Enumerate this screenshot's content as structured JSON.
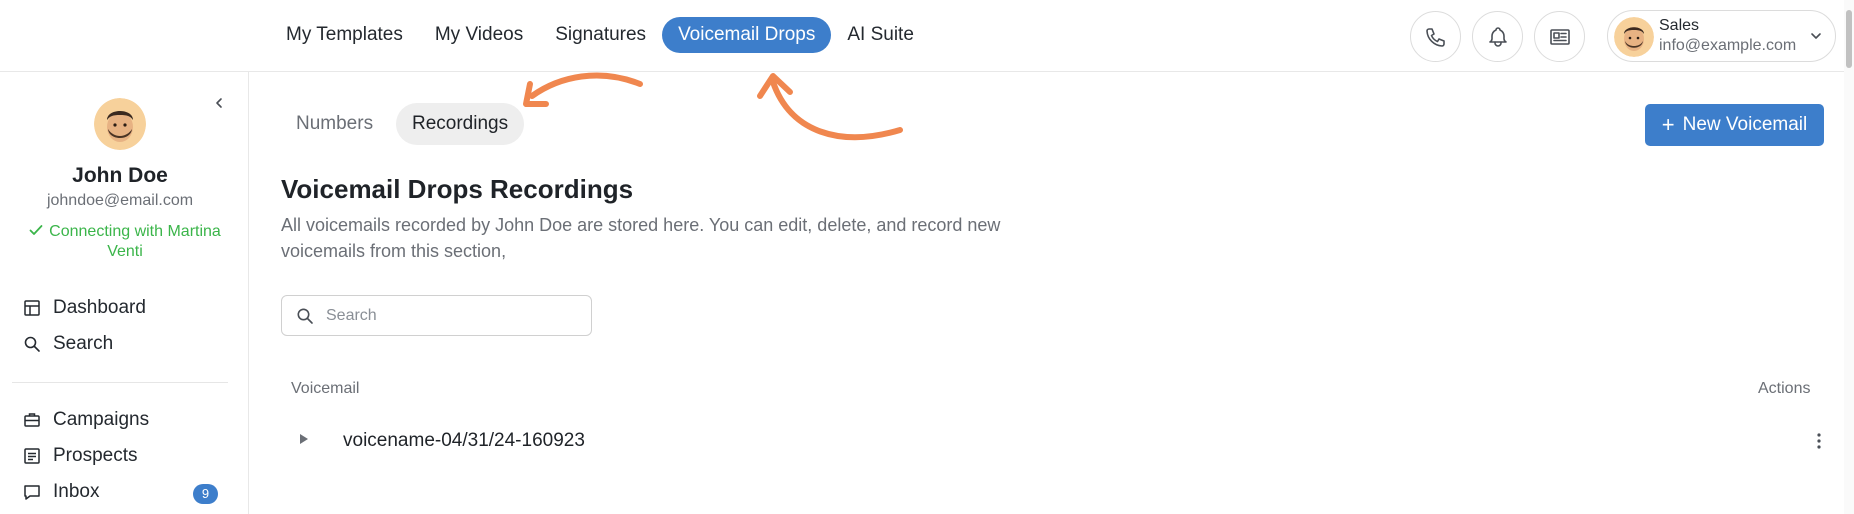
{
  "topnav": {
    "items": [
      {
        "label": "My Templates"
      },
      {
        "label": "My Videos"
      },
      {
        "label": "Signatures"
      },
      {
        "label": "Voicemail Drops",
        "active": true
      },
      {
        "label": "AI Suite"
      }
    ]
  },
  "header_icons": [
    "phone-icon",
    "bell-icon",
    "newspaper-icon"
  ],
  "account": {
    "name": "Sales",
    "email": "info@example.com"
  },
  "sidebar": {
    "profile": {
      "name": "John Doe",
      "email": "johndoe@email.com",
      "status": "Connecting with Martina Venti"
    },
    "items": [
      {
        "label": "Dashboard",
        "icon": "layout-icon"
      },
      {
        "label": "Search",
        "icon": "search-icon"
      },
      {
        "label": "Campaigns",
        "icon": "briefcase-icon"
      },
      {
        "label": "Prospects",
        "icon": "list-icon"
      },
      {
        "label": "Inbox",
        "icon": "message-icon",
        "badge": "9"
      }
    ]
  },
  "main": {
    "tabs": [
      {
        "label": "Numbers"
      },
      {
        "label": "Recordings",
        "active": true
      }
    ],
    "new_button": "New Voicemail",
    "title": "Voicemail Drops Recordings",
    "description": "All voicemails recorded by John Doe are stored here. You can edit, delete, and record new voicemails from this section,",
    "search": {
      "placeholder": "Search",
      "value": ""
    },
    "table": {
      "columns": [
        "Voicemail",
        "Actions"
      ],
      "rows": [
        {
          "name": "voicename-04/31/24-160923"
        }
      ]
    }
  },
  "colors": {
    "accent": "#3d7ecb",
    "status_green": "#3bb54a",
    "annotation_arrow": "#f0874f"
  }
}
